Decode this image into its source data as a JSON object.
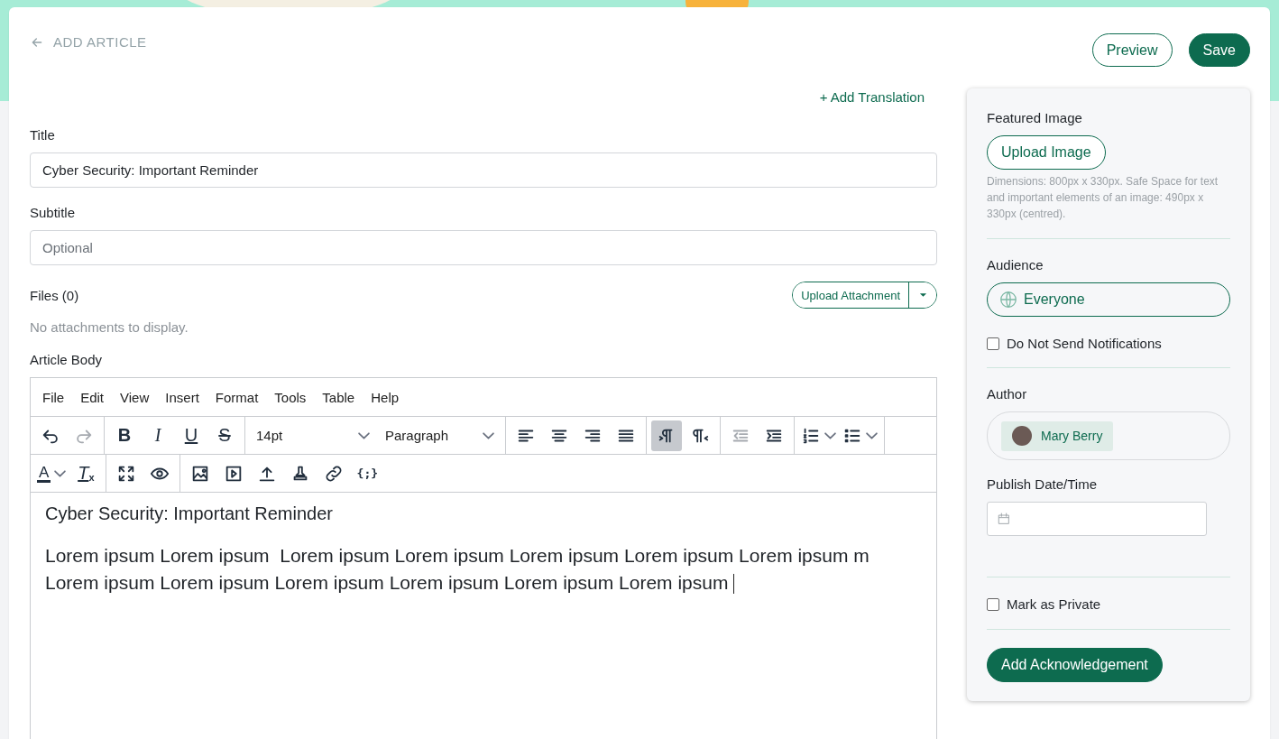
{
  "header": {
    "back_label": "ADD ARTICLE",
    "buttons": [
      {
        "label": "Preview",
        "kind": "outline"
      },
      {
        "label": "Save",
        "kind": "solid"
      }
    ]
  },
  "add_translation": "+ Add Translation",
  "fields": [
    {
      "label": "Title",
      "value": "Cyber Security: Important Reminder"
    },
    {
      "label": "Subtitle",
      "placeholder": "Optional"
    }
  ],
  "files": {
    "label": "Files (0)",
    "upload_button": "Upload Attachment",
    "empty_message": "No attachments to display."
  },
  "editor": {
    "label": "Article Body",
    "menu": [
      "File",
      "Edit",
      "View",
      "Insert",
      "Format",
      "Tools",
      "Table",
      "Help"
    ],
    "history": [
      {
        "disabled": false
      },
      {
        "disabled": true
      }
    ],
    "format_buttons": [
      {
        "label": "B",
        "kind": "bold"
      },
      {
        "label": "I",
        "kind": "italic"
      },
      {
        "label": "U",
        "kind": "underline"
      },
      {
        "label": "S",
        "kind": "strike"
      }
    ],
    "font_size": "14pt",
    "block_format": "Paragraph",
    "direction": [
      {
        "selected": true
      },
      {
        "selected": false
      }
    ],
    "indent": [
      {
        "disabled": true
      },
      {
        "disabled": false
      }
    ],
    "text_color_label": "A",
    "clear_format_label": "T",
    "clear_format_mark": "x",
    "code_label": "{;}",
    "content": {
      "heading": "Cyber Security: Important Reminder",
      "paragraph_lines": [
        "Lorem ipsum Lorem ipsum  Lorem ipsum Lorem ipsum Lorem ipsum Lorem ipsum Lorem ipsum m",
        "Lorem ipsum Lorem ipsum Lorem ipsum Lorem ipsum Lorem ipsum Lorem ipsum "
      ]
    }
  },
  "sidebar": {
    "featured_image": {
      "label": "Featured Image",
      "button": "Upload Image",
      "hint": "Dimensions: 800px x 330px. Safe Space for text and important elements of an image: 490px x 330px (centred)."
    },
    "audience": {
      "label": "Audience",
      "value": "Everyone",
      "do_not_send": {
        "label": "Do Not Send Notifications",
        "checked": false
      }
    },
    "author": {
      "label": "Author",
      "name": "Mary Berry"
    },
    "publish": {
      "label": "Publish Date/Time"
    },
    "private": {
      "label": "Mark as Private",
      "checked": false
    },
    "acknowledgement_button": "Add Acknowledgement"
  }
}
